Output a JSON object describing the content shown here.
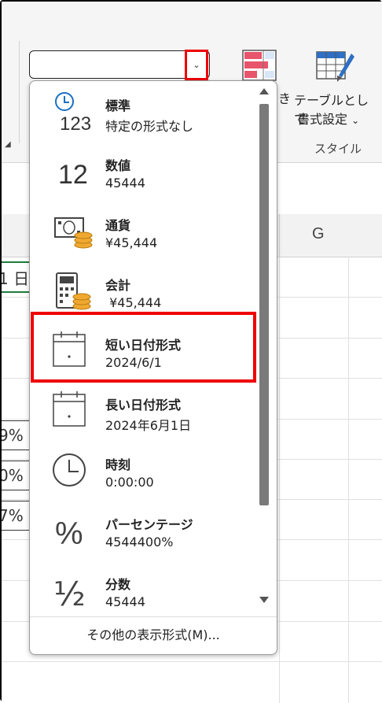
{
  "ribbon": {
    "partial_label": "き",
    "table_format_line1": "テーブルとして",
    "table_format_line2": "書式設定",
    "styles_group": "スタイル",
    "table_format_chevron": "⌄"
  },
  "sheet": {
    "column_g": "G",
    "cell_fragments": [
      "1 日",
      "9%",
      "0%",
      "7%"
    ]
  },
  "number_format_menu": {
    "dropdown_chevron": "⌄",
    "items": [
      {
        "name": "標準",
        "sample": "特定の形式なし",
        "icon": "clock-123-icon",
        "icon_text": "123"
      },
      {
        "name": "数値",
        "sample": "45444",
        "icon": "number-12-icon",
        "icon_text": "12"
      },
      {
        "name": "通貨",
        "sample": "¥45,444",
        "icon": "currency-icon"
      },
      {
        "name": "会計",
        "sample": " ¥45,444",
        "icon": "accounting-icon"
      },
      {
        "name": "短い日付形式",
        "sample": "2024/6/1",
        "icon": "calendar-icon"
      },
      {
        "name": "長い日付形式",
        "sample": "2024年6月1日",
        "icon": "calendar-icon"
      },
      {
        "name": "時刻",
        "sample": "0:00:00",
        "icon": "clock-icon"
      },
      {
        "name": "パーセンテージ",
        "sample": "4544400%",
        "icon": "percent-icon",
        "icon_text": "%"
      },
      {
        "name": "分数",
        "sample": "45444",
        "icon": "fraction-icon",
        "icon_text": "½"
      }
    ],
    "more_formats": "その他の表示形式(M)..."
  },
  "colors": {
    "highlight": "#e00000",
    "coin": "#f0a830",
    "clock_blue": "#1a6fc4",
    "scroll_thumb": "#7a7a7a"
  }
}
